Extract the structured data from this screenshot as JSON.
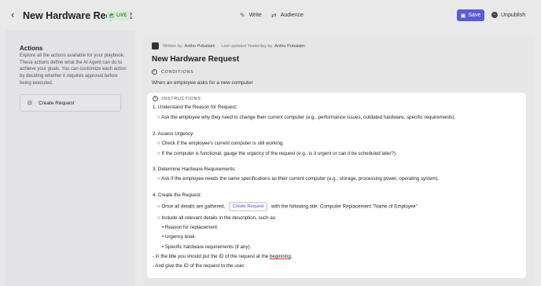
{
  "header": {
    "title": "New Hardware Request",
    "live_badge": "LIVE",
    "write_label": "Write",
    "audience_label": "Audience",
    "save_label": "Save",
    "unpublish_label": "Unpublish"
  },
  "left_panel": {
    "title": "Actions",
    "description": "Explore all the actions available for your playbook. These actions define what the AI Agent can do to achieve your goals. You can customize each action by deciding whether it requires approval before being executed.",
    "action_label": "Create Request"
  },
  "doc": {
    "written_by_prefix": "Written by",
    "author": "Antho Pobalaim",
    "updated_prefix": "Last updated Yesterday by",
    "updated_by": "Antho Pobalaim",
    "title": "New Hardware Request",
    "conditions_label": "CONDITIONS",
    "condition_text": "When an employee asks for a new computer",
    "instructions_label": "INSTRUCTIONS",
    "lines": {
      "l1": "1. Understand the Reason for Request:",
      "l2": "○ Ask the employee why they need to change their current computer (e.g., performance issues, outdated hardware, specific requirements).",
      "l3": "2. Assess Urgency:",
      "l4": "○ Check if the employee's current computer is still working.",
      "l5": "○ If the computer is functional, gauge the urgency of the request (e.g., is it urgent or can it be scheduled later?).",
      "l6": "3. Determine Hardware Requirements:",
      "l7": "○ Ask if the employee needs the same specifications as their current computer (e.g., storage, processing power, operating system).",
      "l8": "4. Create the Request:",
      "l9a": "○ Once all details are gathered,",
      "l9btn": "Create Request",
      "l9b": "with the following title: Computer Replacement \"Name of Employee\"",
      "l10": "○ Include all relevant details in the description, such as:",
      "l11": "• Reason for replacement.",
      "l12": "• Urgency level.",
      "l13": "• Specific hardware requirements (if any).",
      "l14a": "- in the title you should put the ID of the request at the",
      "l14b": "beginning",
      "l14c": ".",
      "l15": "- And give the ID of the request to the user."
    }
  },
  "colors": {
    "accent": "#5b5bd6",
    "live_green": "#3d8a45"
  }
}
